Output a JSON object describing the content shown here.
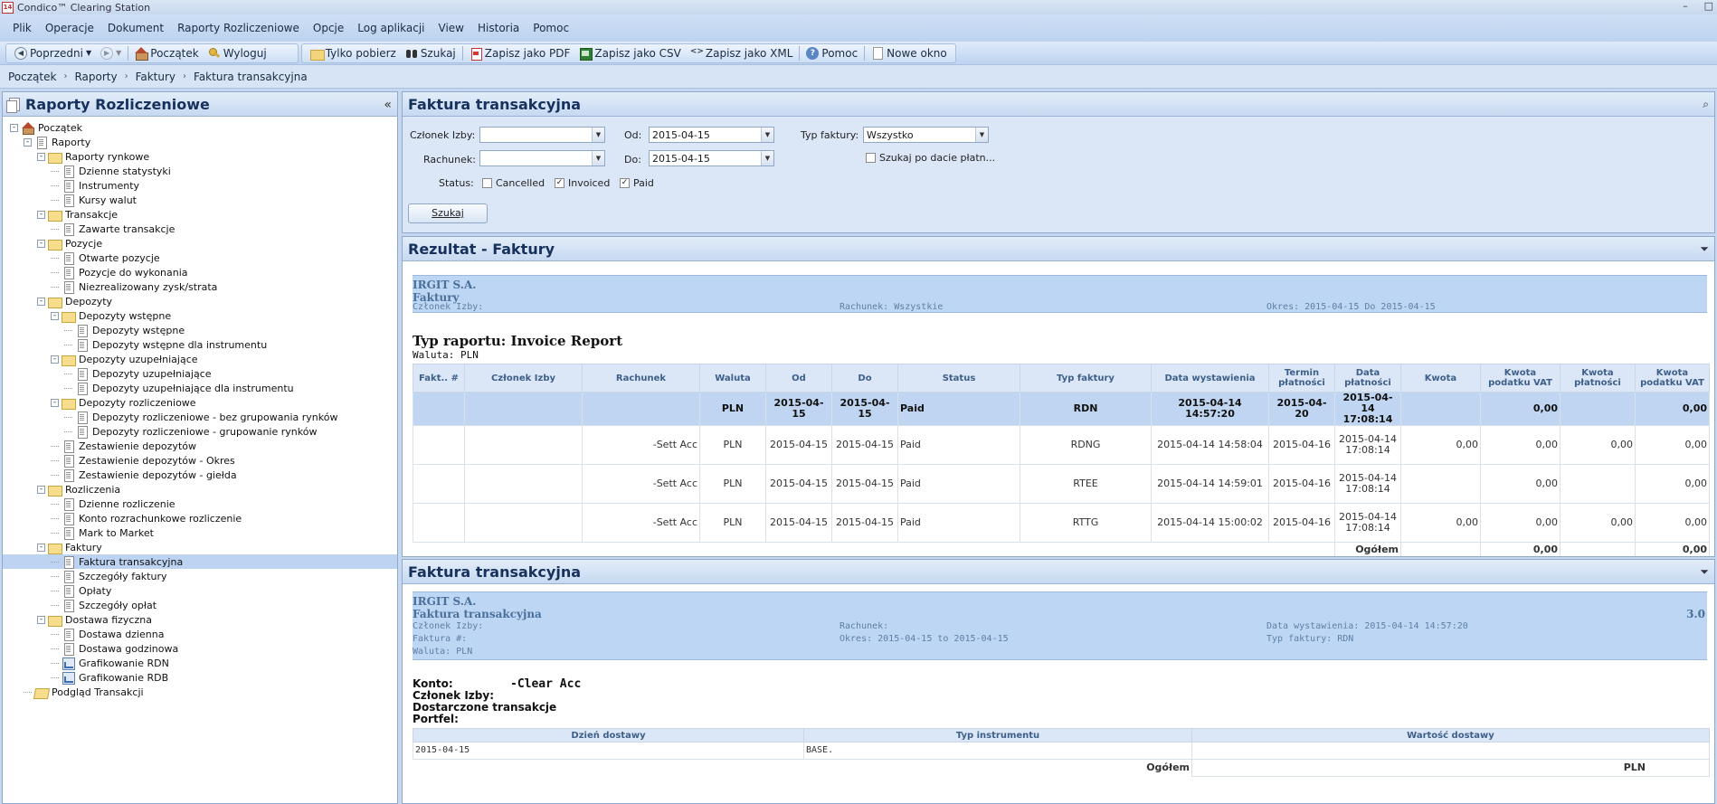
{
  "window": {
    "title": "Condico™ Clearing Station",
    "icon_text": "14",
    "controls": [
      "–",
      "□"
    ]
  },
  "menu": [
    "Plik",
    "Operacje",
    "Dokument",
    "Raporty Rozliczeniowe",
    "Opcje",
    "Log aplikacji",
    "View",
    "Historia",
    "Pomoc"
  ],
  "toolbar": {
    "prev": "Poprzedni",
    "home": "Początek",
    "logout": "Wyloguj",
    "only_fetch": "Tylko pobierz",
    "search": "Szukaj",
    "save_pdf": "Zapisz jako PDF",
    "save_csv": "Zapisz jako CSV",
    "save_xml": "Zapisz jako XML",
    "help": "Pomoc",
    "new_window": "Nowe okno"
  },
  "breadcrumb": [
    "Początek",
    "Raporty",
    "Faktury",
    "Faktura transakcyjna"
  ],
  "left_panel": {
    "title": "Raporty Rozliczeniowe",
    "tree": [
      {
        "label": "Początek",
        "level": 0,
        "icon": "home",
        "exp": "-"
      },
      {
        "label": "Raporty",
        "level": 1,
        "icon": "doc",
        "exp": "-"
      },
      {
        "label": "Raporty rynkowe",
        "level": 2,
        "icon": "folder",
        "exp": "-"
      },
      {
        "label": "Dzienne statystyki",
        "level": 3,
        "icon": "doc"
      },
      {
        "label": "Instrumenty",
        "level": 3,
        "icon": "doc"
      },
      {
        "label": "Kursy walut",
        "level": 3,
        "icon": "doc"
      },
      {
        "label": "Transakcje",
        "level": 2,
        "icon": "folder",
        "exp": "-"
      },
      {
        "label": "Zawarte transakcje",
        "level": 3,
        "icon": "doc"
      },
      {
        "label": "Pozycje",
        "level": 2,
        "icon": "folder",
        "exp": "-"
      },
      {
        "label": "Otwarte pozycje",
        "level": 3,
        "icon": "doc"
      },
      {
        "label": "Pozycje do wykonania",
        "level": 3,
        "icon": "doc"
      },
      {
        "label": "Niezrealizowany zysk/strata",
        "level": 3,
        "icon": "doc"
      },
      {
        "label": "Depozyty",
        "level": 2,
        "icon": "folder",
        "exp": "-"
      },
      {
        "label": "Depozyty wstępne",
        "level": 3,
        "icon": "folder",
        "exp": "-"
      },
      {
        "label": "Depozyty wstępne",
        "level": 4,
        "icon": "doc"
      },
      {
        "label": "Depozyty wstępne dla instrumentu",
        "level": 4,
        "icon": "doc"
      },
      {
        "label": "Depozyty uzupełniające",
        "level": 3,
        "icon": "folder",
        "exp": "-"
      },
      {
        "label": "Depozyty uzupełniające",
        "level": 4,
        "icon": "doc"
      },
      {
        "label": "Depozyty uzupełniające dla instrumentu",
        "level": 4,
        "icon": "doc"
      },
      {
        "label": "Depozyty rozliczeniowe",
        "level": 3,
        "icon": "folder",
        "exp": "-"
      },
      {
        "label": "Depozyty rozliczeniowe - bez grupowania rynków",
        "level": 4,
        "icon": "doc"
      },
      {
        "label": "Depozyty rozliczeniowe - grupowanie rynków",
        "level": 4,
        "icon": "doc"
      },
      {
        "label": "Zestawienie depozytów",
        "level": 3,
        "icon": "doc"
      },
      {
        "label": "Zestawienie depozytów - Okres",
        "level": 3,
        "icon": "doc"
      },
      {
        "label": "Zestawienie depozytów - giełda",
        "level": 3,
        "icon": "doc"
      },
      {
        "label": "Rozliczenia",
        "level": 2,
        "icon": "folder",
        "exp": "-"
      },
      {
        "label": "Dzienne rozliczenie",
        "level": 3,
        "icon": "doc"
      },
      {
        "label": "Konto rozrachunkowe rozliczenie",
        "level": 3,
        "icon": "doc"
      },
      {
        "label": "Mark to Market",
        "level": 3,
        "icon": "doc"
      },
      {
        "label": "Faktury",
        "level": 2,
        "icon": "folder",
        "exp": "-"
      },
      {
        "label": "Faktura transakcyjna",
        "level": 3,
        "icon": "doc",
        "selected": true
      },
      {
        "label": "Szczegóły faktury",
        "level": 3,
        "icon": "doc"
      },
      {
        "label": "Opłaty",
        "level": 3,
        "icon": "doc"
      },
      {
        "label": "Szczegóły opłat",
        "level": 3,
        "icon": "doc"
      },
      {
        "label": "Dostawa fizyczna",
        "level": 2,
        "icon": "folder",
        "exp": "-"
      },
      {
        "label": "Dostawa dzienna",
        "level": 3,
        "icon": "doc"
      },
      {
        "label": "Dostawa godzinowa",
        "level": 3,
        "icon": "doc"
      },
      {
        "label": "Grafikowanie RDN",
        "level": 3,
        "icon": "chart"
      },
      {
        "label": "Grafikowanie RDB",
        "level": 3,
        "icon": "chart"
      },
      {
        "label": "Podgląd Transakcji",
        "level": 1,
        "icon": "openfolder"
      }
    ]
  },
  "filter_panel": {
    "title": "Faktura transakcyjna",
    "member_label": "Członek Izby:",
    "member_value": "",
    "account_label": "Rachunek:",
    "account_value": "",
    "from_label": "Od:",
    "from_value": "2015-04-15",
    "to_label": "Do:",
    "to_value": "2015-04-15",
    "type_label": "Typ faktury:",
    "type_value": "Wszystko",
    "by_payment_date": "Szukaj po dacie płatn...",
    "status_label": "Status:",
    "statuses": [
      {
        "label": "Cancelled",
        "checked": false
      },
      {
        "label": "Invoiced",
        "checked": true
      },
      {
        "label": "Paid",
        "checked": true
      }
    ],
    "search_button": "Szukaj"
  },
  "results_panel": {
    "title": "Rezultat - Faktury",
    "banner": {
      "company": "IRGIT S.A.",
      "title": "Faktury",
      "member": "Członek Izby:",
      "account": "Rachunek: Wszystkie",
      "period": "Okres: 2015-04-15 Do 2015-04-15"
    },
    "report_type": "Typ raportu: Invoice Report",
    "currency": "Waluta: PLN",
    "columns": [
      "Fakt.. #",
      "Członek Izby",
      "Rachunek",
      "Waluta",
      "Od",
      "Do",
      "Status",
      "Typ faktury",
      "Data wystawienia",
      "Termin płatności",
      "Data płatności",
      "Kwota",
      "Kwota podatku VAT",
      "Kwota płatności",
      "Kwota podatku VAT"
    ],
    "rows": [
      [
        "",
        "",
        "",
        "PLN",
        "2015-04-15",
        "2015-04-15",
        "Paid",
        "RDN",
        "2015-04-14 14:57:20",
        "2015-04-20",
        "2015-04-14 17:08:14",
        "",
        "0,00",
        "",
        "0,00"
      ],
      [
        "",
        "",
        "-Sett Acc",
        "PLN",
        "2015-04-15",
        "2015-04-15",
        "Paid",
        "RDNG",
        "2015-04-14 14:58:04",
        "2015-04-16",
        "2015-04-14 17:08:14",
        "0,00",
        "0,00",
        "0,00",
        "0,00"
      ],
      [
        "",
        "",
        "-Sett Acc",
        "PLN",
        "2015-04-15",
        "2015-04-15",
        "Paid",
        "RTEE",
        "2015-04-14 14:59:01",
        "2015-04-16",
        "2015-04-14 17:08:14",
        "",
        "0,00",
        "",
        "0,00"
      ],
      [
        "",
        "",
        "-Sett Acc",
        "PLN",
        "2015-04-15",
        "2015-04-15",
        "Paid",
        "RTTG",
        "2015-04-14 15:00:02",
        "2015-04-16",
        "2015-04-14 17:08:14",
        "0,00",
        "0,00",
        "0,00",
        "0,00"
      ]
    ],
    "total_label": "Ogółem",
    "total_vat": "0,00",
    "total_vat2": "0,00"
  },
  "invoice_panel": {
    "title": "Faktura transakcyjna",
    "banner": {
      "company": "IRGIT S.A.",
      "title": "Faktura transakcyjna",
      "version": "3.0",
      "member": "Członek Izby:",
      "invoice_no": "Faktura #:",
      "currency": "Waluta: PLN",
      "account": "Rachunek:",
      "period": "Okres: 2015-04-15 to 2015-04-15",
      "issue_date": "Data wystawienia: 2015-04-14 14:57:20",
      "invoice_type": "Typ faktury: RDN"
    },
    "account_label": "Konto:",
    "account_value": "-Clear Acc",
    "member_label": "Członek Izby:",
    "delivered_label": "Dostarczone transakcje",
    "portfolio_label": "Portfel:",
    "columns": [
      "Dzień dostawy",
      "Typ instrumentu",
      "Wartość dostawy"
    ],
    "rows": [
      [
        "2015-04-15",
        "BASE.",
        ""
      ]
    ],
    "total_label": "Ogółem",
    "total_value": "PLN"
  }
}
